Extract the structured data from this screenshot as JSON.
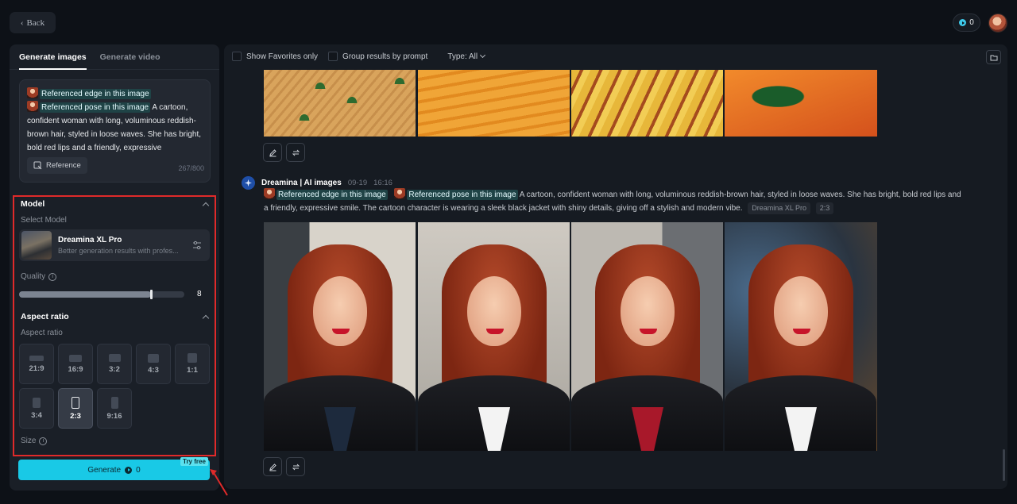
{
  "header": {
    "back_label": "Back",
    "credits": "0"
  },
  "left": {
    "tabs": [
      {
        "label": "Generate images",
        "active": true
      },
      {
        "label": "Generate video",
        "active": false
      }
    ],
    "prompt": {
      "ref1": "Referenced edge in this image",
      "ref2": "Referenced pose in this image",
      "text": "A cartoon, confident woman with long, voluminous reddish-brown hair, styled in loose waves. She has bright, bold red lips and a friendly, expressive",
      "reference_button": "Reference",
      "char_count": "267/800"
    },
    "model": {
      "section_title": "Model",
      "select_label": "Select Model",
      "name": "Dreamina XL Pro",
      "description": "Better generation results with profes..."
    },
    "quality": {
      "label": "Quality",
      "value": "8",
      "fraction": 0.8
    },
    "aspect": {
      "section_title": "Aspect ratio",
      "label": "Aspect ratio",
      "options": [
        "21:9",
        "16:9",
        "3:2",
        "4:3",
        "1:1",
        "3:4",
        "2:3",
        "9:16"
      ],
      "selected": "2:3"
    },
    "size_label": "Size",
    "generate": {
      "label": "Generate",
      "cost": "0",
      "badge": "Try free"
    }
  },
  "main": {
    "toolbar": {
      "favorites_label": "Show Favorites only",
      "group_label": "Group results by prompt",
      "type_label": "Type: All"
    },
    "generation": {
      "title": "Dreamina | AI images",
      "date": "09-19",
      "time": "16:16",
      "ref1": "Referenced edge in this image",
      "ref2": "Referenced pose in this image",
      "prompt": "A cartoon, confident woman with long, voluminous reddish-brown hair, styled in loose waves. She has bright, bold red lips and a friendly, expressive smile. The cartoon character is wearing a sleek black jacket with shiny details, giving off a stylish and modern vibe.",
      "model_chip": "Dreamina XL Pro",
      "ratio_chip": "2:3"
    }
  },
  "colors": {
    "accent": "#19c9e6",
    "highlight_border": "#e02a2a",
    "background": "#0d1117"
  }
}
